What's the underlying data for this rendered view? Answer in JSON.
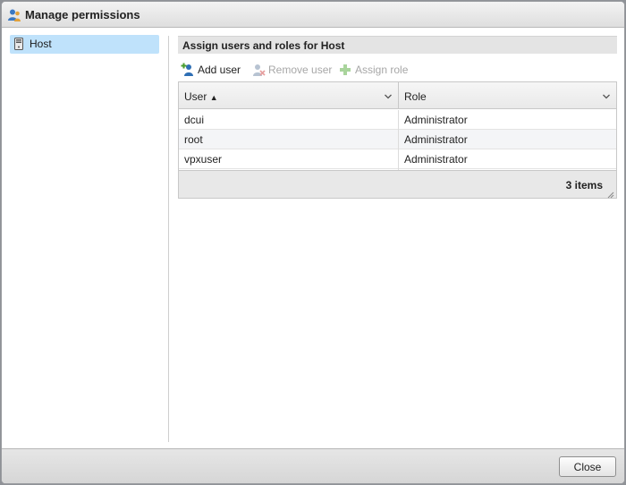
{
  "dialog": {
    "title": "Manage permissions",
    "title_icon": "users-icon"
  },
  "sidebar": {
    "items": [
      {
        "label": "Host",
        "icon": "host-server-icon",
        "selected": true
      }
    ]
  },
  "panel": {
    "title": "Assign users and roles for Host"
  },
  "toolbar": {
    "add_user": {
      "label": "Add user",
      "icon": "add-user-icon",
      "enabled": true
    },
    "remove_user": {
      "label": "Remove user",
      "icon": "remove-user-icon",
      "enabled": false
    },
    "assign_role": {
      "label": "Assign role",
      "icon": "plus-icon",
      "enabled": false
    }
  },
  "grid": {
    "columns": [
      {
        "label": "User",
        "sort": "ascending",
        "sort_glyph": "▲"
      },
      {
        "label": "Role"
      }
    ],
    "rows": [
      {
        "user": "dcui",
        "role": "Administrator"
      },
      {
        "user": "root",
        "role": "Administrator"
      },
      {
        "user": "vpxuser",
        "role": "Administrator"
      }
    ],
    "item_count": "3 items"
  },
  "footer": {
    "close_label": "Close"
  },
  "colors": {
    "selection": "#bfe2fb",
    "header_bg": "#e4e4e4",
    "add_icon_green": "#4a9e2f",
    "user_icon_blue": "#2f6fb5"
  }
}
